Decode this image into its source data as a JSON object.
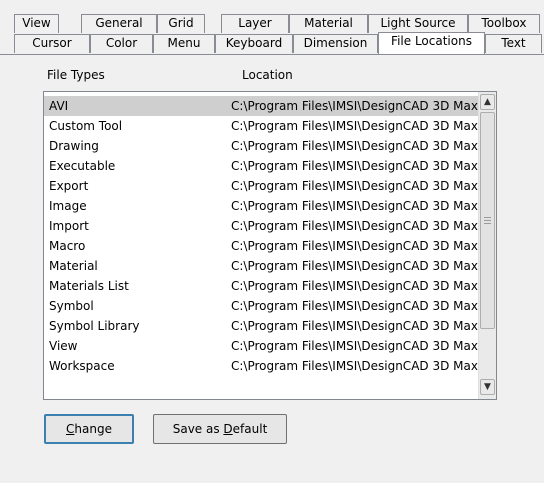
{
  "tabs_back": [
    "View",
    "General",
    "Grid",
    "Layer",
    "Material",
    "Light Source",
    "Toolbox"
  ],
  "tabs_front": [
    "Cursor",
    "Color",
    "Menu",
    "Keyboard",
    "Dimension",
    "File Locations",
    "Text"
  ],
  "active_tab": "File Locations",
  "list": {
    "header_type": "File Types",
    "header_location": "Location",
    "rows": [
      {
        "type": "AVI",
        "location": "C:\\Program Files\\IMSI\\DesignCAD 3D Max"
      },
      {
        "type": "Custom Tool",
        "location": "C:\\Program Files\\IMSI\\DesignCAD 3D Max"
      },
      {
        "type": "Drawing",
        "location": "C:\\Program Files\\IMSI\\DesignCAD 3D Max"
      },
      {
        "type": "Executable",
        "location": "C:\\Program Files\\IMSI\\DesignCAD 3D Max"
      },
      {
        "type": "Export",
        "location": "C:\\Program Files\\IMSI\\DesignCAD 3D Max"
      },
      {
        "type": "Image",
        "location": "C:\\Program Files\\IMSI\\DesignCAD 3D Max"
      },
      {
        "type": "Import",
        "location": "C:\\Program Files\\IMSI\\DesignCAD 3D Max"
      },
      {
        "type": "Macro",
        "location": "C:\\Program Files\\IMSI\\DesignCAD 3D Max"
      },
      {
        "type": "Material",
        "location": "C:\\Program Files\\IMSI\\DesignCAD 3D Max"
      },
      {
        "type": "Materials List",
        "location": "C:\\Program Files\\IMSI\\DesignCAD 3D Max"
      },
      {
        "type": "Symbol",
        "location": "C:\\Program Files\\IMSI\\DesignCAD 3D Max"
      },
      {
        "type": "Symbol Library",
        "location": "C:\\Program Files\\IMSI\\DesignCAD 3D Max"
      },
      {
        "type": "View",
        "location": "C:\\Program Files\\IMSI\\DesignCAD 3D Max"
      },
      {
        "type": "Workspace",
        "location": "C:\\Program Files\\IMSI\\DesignCAD 3D Max"
      }
    ],
    "selected_index": 0
  },
  "buttons": {
    "change_mnemonic": "C",
    "change_rest": "hange",
    "save_prefix": "Save as ",
    "save_mnemonic": "D",
    "save_rest": "efault"
  },
  "icons": {
    "scroll_up": "chevron-up-icon",
    "scroll_down": "chevron-down-icon",
    "thumb_grip": "grip-icon"
  },
  "colors": {
    "selection": "#cfcfcf",
    "default_button_border": "#3c7fb1"
  }
}
